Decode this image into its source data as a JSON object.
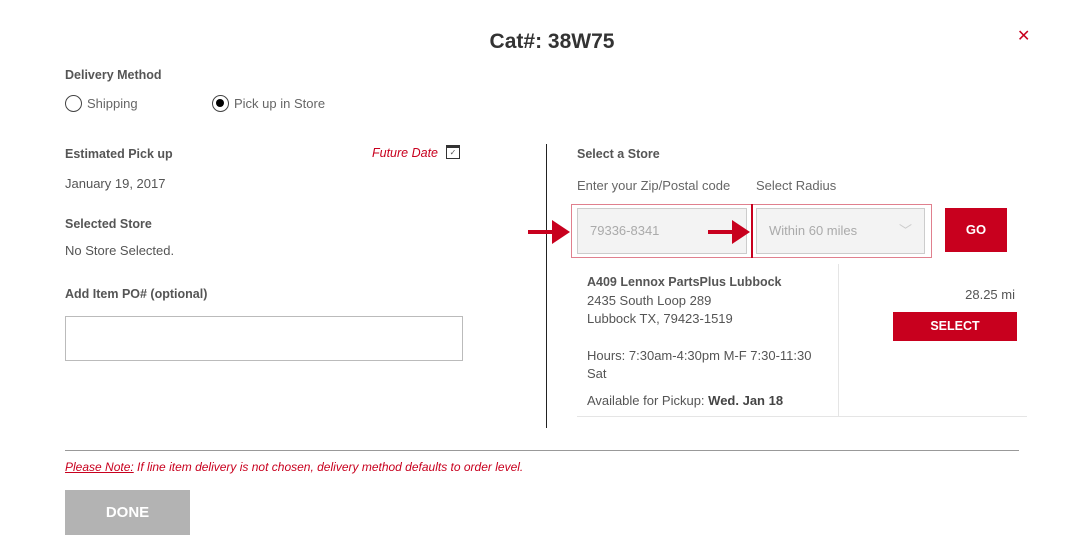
{
  "header": {
    "title": "Cat#: 38W75",
    "close_icon": "close-icon"
  },
  "delivery": {
    "label": "Delivery Method",
    "options": [
      {
        "label": "Shipping",
        "selected": false
      },
      {
        "label": "Pick up in Store",
        "selected": true
      }
    ]
  },
  "pickup": {
    "label": "Estimated Pick up",
    "future_date": "Future Date",
    "date": "January 19, 2017"
  },
  "selected_store": {
    "label": "Selected Store",
    "value": "No Store Selected."
  },
  "po": {
    "label": "Add Item PO# (optional)",
    "value": ""
  },
  "store_search": {
    "title": "Select a Store",
    "zip_label": "Enter your Zip/Postal code",
    "zip_placeholder": "79336-8341",
    "radius_label": "Select Radius",
    "radius_value": "Within 60 miles",
    "go": "GO"
  },
  "store": {
    "name": "A409 Lennox PartsPlus Lubbock",
    "address1": "2435 South Loop 289",
    "address2": "Lubbock TX, 79423-1519",
    "hours": "Hours: 7:30am-4:30pm M-F 7:30-11:30 Sat",
    "avail_label": "Available for Pickup:",
    "avail_value": "Wed. Jan 18",
    "distance": "28.25 mi",
    "select": "SELECT"
  },
  "note": {
    "prefix": "Please Note:",
    "text": " If line item delivery is not chosen, delivery method defaults to order level."
  },
  "done": "DONE",
  "colors": {
    "accent": "#c8001e",
    "done_bg": "#b3b3b3"
  }
}
